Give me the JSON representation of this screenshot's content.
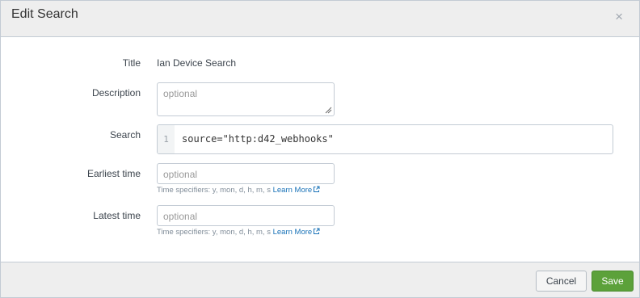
{
  "dialog": {
    "title": "Edit Search",
    "close_glyph": "×"
  },
  "form": {
    "title": {
      "label": "Title",
      "value": "Ian Device Search"
    },
    "description": {
      "label": "Description",
      "placeholder": "optional"
    },
    "search": {
      "label": "Search",
      "line_number": "1",
      "query": "source=\"http:d42_webhooks\""
    },
    "earliest_time": {
      "label": "Earliest time",
      "placeholder": "optional",
      "help": "Time specifiers: y, mon, d, h, m, s",
      "learn_more": "Learn More"
    },
    "latest_time": {
      "label": "Latest time",
      "placeholder": "optional",
      "help": "Time specifiers: y, mon, d, h, m, s",
      "learn_more": "Learn More"
    }
  },
  "footer": {
    "cancel_label": "Cancel",
    "save_label": "Save"
  },
  "colors": {
    "save_button": "#5ca13a",
    "link": "#1a73b8",
    "header_bg": "#eeeeee"
  },
  "icons": {
    "close": "close-icon",
    "external_link": "external-link-icon",
    "resize": "resize-grip-icon"
  }
}
